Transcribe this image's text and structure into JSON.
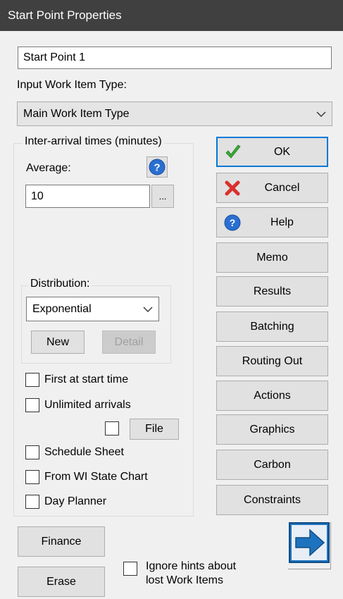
{
  "window": {
    "title": "Start Point Properties"
  },
  "name_field": {
    "value": "Start Point 1"
  },
  "input_type": {
    "label": "Input Work Item Type:",
    "selected": "Main Work Item Type"
  },
  "interarrival": {
    "group_title": "Inter-arrival times (minutes)",
    "average_label": "Average:",
    "average_value": "10",
    "ellipsis_label": "...",
    "distribution": {
      "group_title": "Distribution:",
      "selected": "Exponential",
      "new_label": "New",
      "detail_label": "Detail"
    },
    "first_at_start_label": "First at start time",
    "unlimited_label": "Unlimited arrivals",
    "file_label": "File",
    "schedule_label": "Schedule Sheet",
    "state_chart_label": "From WI State Chart",
    "day_planner_label": "Day Planner"
  },
  "buttons": {
    "ok": "OK",
    "cancel": "Cancel",
    "help": "Help",
    "memo": "Memo",
    "results": "Results",
    "batching": "Batching",
    "routing_out": "Routing Out",
    "actions": "Actions",
    "graphics": "Graphics",
    "carbon": "Carbon",
    "constraints": "Constraints",
    "finance": "Finance",
    "erase": "Erase"
  },
  "ignore_hints": {
    "line1": "Ignore hints about",
    "line2": "lost Work Items"
  },
  "colors": {
    "titlebar": "#404040",
    "accent": "#0078d7",
    "ok_check": "#3aaa35",
    "cancel_x": "#d9302c"
  }
}
